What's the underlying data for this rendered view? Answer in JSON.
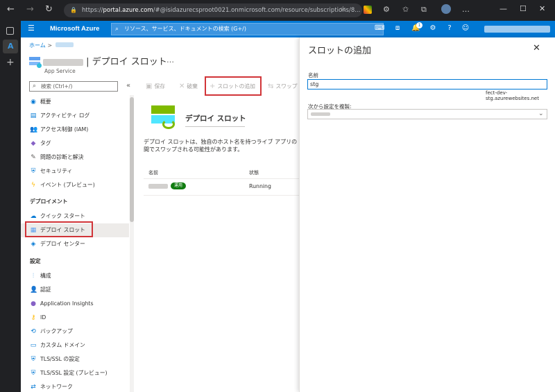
{
  "browser": {
    "url_prefix": "https://",
    "url_host": "portal.azure.com",
    "url_rest": "/#@isidazurecsproot0021.onmicrosoft.com/resource/subscriptions/8..."
  },
  "topbar": {
    "brand": "Microsoft Azure",
    "search_placeholder": "リソース、サービス、ドキュメントの検索 (G+/)",
    "notification_count": "1"
  },
  "breadcrumb": {
    "home": "ホーム",
    "sep": ">"
  },
  "resource": {
    "title_suffix": "| デプロイ スロット",
    "type": "App Service",
    "more": "…"
  },
  "menu": {
    "search_placeholder": "検索 (Ctrl+/)",
    "collapse": "«",
    "items_top": [
      {
        "label": "概要",
        "icon": "globe-icon",
        "color": "#0078d4"
      },
      {
        "label": "アクティビティ ログ",
        "icon": "log-icon",
        "color": "#0078d4"
      },
      {
        "label": "アクセス制御 (IAM)",
        "icon": "people-icon",
        "color": "#0078d4"
      },
      {
        "label": "タグ",
        "icon": "tag-icon",
        "color": "#8661c5"
      },
      {
        "label": "問題の診断と解決",
        "icon": "wrench-icon",
        "color": "#605e5c"
      },
      {
        "label": "セキュリティ",
        "icon": "shield-icon",
        "color": "#0078d4"
      },
      {
        "label": "イベント (プレビュー)",
        "icon": "lightning-icon",
        "color": "#ffb900"
      }
    ],
    "section_deploy": "デプロイメント",
    "items_deploy": [
      {
        "label": "クイック スタート",
        "icon": "cloud-icon",
        "color": "#0078d4"
      },
      {
        "label": "デプロイ スロット",
        "icon": "slots-icon",
        "color": "#5ea0ef"
      },
      {
        "label": "デプロイ センター",
        "icon": "cube-icon",
        "color": "#0078d4"
      }
    ],
    "section_settings": "設定",
    "items_settings": [
      {
        "label": "構成",
        "icon": "sliders-icon",
        "color": "#0078d4"
      },
      {
        "label": "認証",
        "icon": "user-key-icon",
        "color": "#0078d4"
      },
      {
        "label": "Application Insights",
        "icon": "bulb-icon",
        "color": "#8661c5"
      },
      {
        "label": "ID",
        "icon": "key-icon",
        "color": "#ffb900"
      },
      {
        "label": "バックアップ",
        "icon": "backup-icon",
        "color": "#0078d4"
      },
      {
        "label": "カスタム ドメイン",
        "icon": "domain-icon",
        "color": "#0078d4"
      },
      {
        "label": "TLS/SSL の設定",
        "icon": "shield-icon",
        "color": "#0078d4"
      },
      {
        "label": "TLS/SSL 設定 (プレビュー)",
        "icon": "shield-icon",
        "color": "#0078d4"
      },
      {
        "label": "ネットワーク",
        "icon": "network-icon",
        "color": "#0078d4"
      }
    ]
  },
  "toolbar": {
    "save": "保存",
    "discard": "破棄",
    "add_slot": "スロットの追加",
    "swap": "スワップ"
  },
  "content": {
    "title": "デプロイ スロット",
    "description": "デプロイ スロットは、独自のホスト名を持つライブ アプリの間でスワップされる可能性があります。",
    "col_name": "名前",
    "col_status": "状態",
    "row_badge": "運用",
    "row_status": "Running"
  },
  "panel": {
    "title": "スロットの追加",
    "close": "✕",
    "name_label": "名前",
    "name_value": "stg",
    "name_suffix": "fect-dev-stg.azurewebsites.net",
    "clone_label": "次から設定を複製:"
  },
  "colors": {
    "azure_blue": "#0078d4",
    "highlight_red": "#d13438",
    "running_green": "#107c10"
  }
}
